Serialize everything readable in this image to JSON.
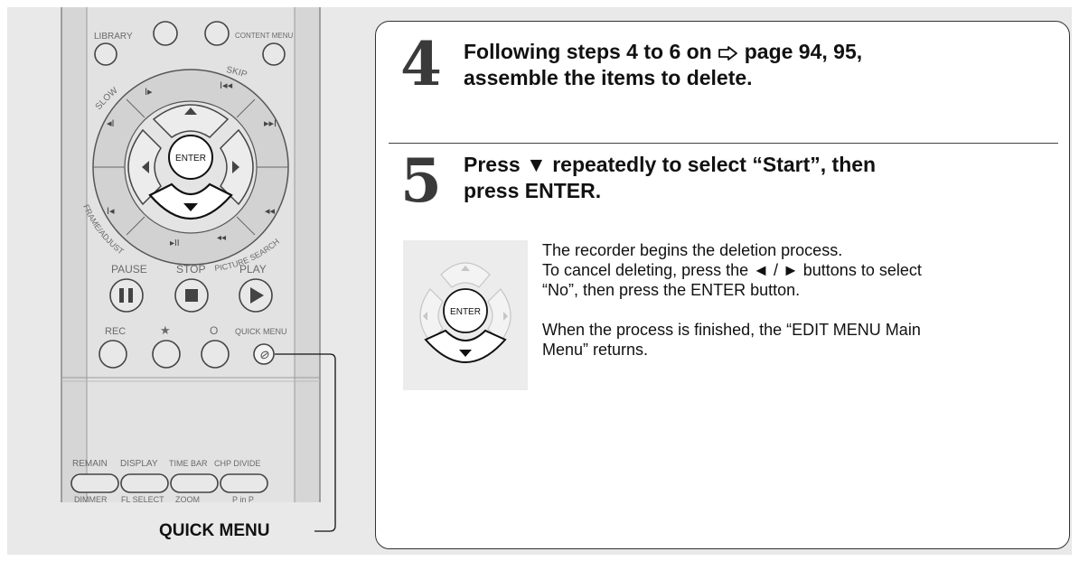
{
  "remote": {
    "labels": {
      "library": "LIBRARY",
      "content_menu": "CONTENT MENU",
      "slow": "SLOW",
      "skip": "SKIP",
      "enter": "ENTER",
      "frame_adjust": "FRAME/ADJUST",
      "picture_search": "PICTURE SEARCH",
      "pause": "PAUSE",
      "stop": "STOP",
      "play": "PLAY",
      "rec": "REC",
      "star": "★",
      "circle": "O",
      "quick_menu": "QUICK MENU",
      "remain": "REMAIN",
      "display": "DISPLAY",
      "time_bar": "TIME BAR",
      "chp_divide": "CHP DIVIDE",
      "dimmer": "DIMMER",
      "fl_select": "FL SELECT",
      "zoom": "ZOOM",
      "p_in_p": "P in P"
    },
    "callout_label": "QUICK MENU"
  },
  "steps": [
    {
      "number": "4",
      "text_prefix": "Following steps 4 to 6 on",
      "text_suffix": "page 94, 95,",
      "line2": "assemble the items to delete."
    },
    {
      "number": "5",
      "line1": "Press ▼ repeatedly to select “Start”, then",
      "line2": "press ENTER."
    }
  ],
  "thumbnail": {
    "enter_label": "ENTER"
  },
  "description": {
    "line1": "The recorder begins the deletion process.",
    "line2": "To cancel deleting, press the ◄ / ► buttons to select",
    "line3": "“No”, then press the ENTER button.",
    "line4": "When the process is finished, the “EDIT MENU Main",
    "line5": "Menu” returns."
  },
  "colors": {
    "panel_bg": "#e9e9e9",
    "remote_body": "#d6d6d6",
    "text": "#111111"
  }
}
